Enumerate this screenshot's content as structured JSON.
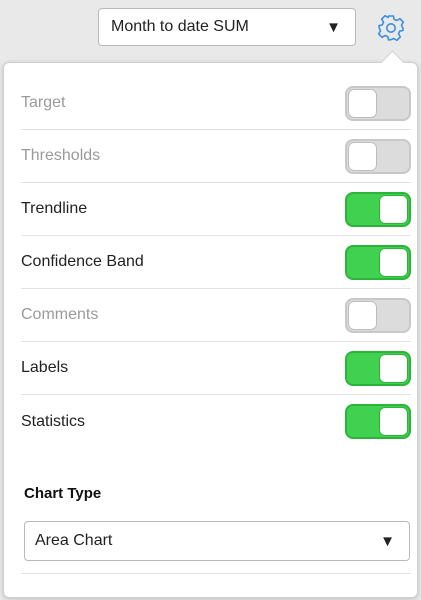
{
  "header": {
    "aggregation_select": {
      "value": "Month to date SUM",
      "caret": "▼"
    },
    "settings_icon": "gear-icon"
  },
  "settings": {
    "rows": [
      {
        "label": "Target",
        "enabled": false,
        "on": false
      },
      {
        "label": "Thresholds",
        "enabled": false,
        "on": false
      },
      {
        "label": "Trendline",
        "enabled": true,
        "on": true
      },
      {
        "label": "Confidence Band",
        "enabled": true,
        "on": true
      },
      {
        "label": "Comments",
        "enabled": false,
        "on": false
      },
      {
        "label": "Labels",
        "enabled": true,
        "on": true
      },
      {
        "label": "Statistics",
        "enabled": true,
        "on": true
      }
    ],
    "chart_type": {
      "title": "Chart Type",
      "value": "Area Chart",
      "caret": "▼"
    }
  },
  "colors": {
    "accent": "#3b8ee0",
    "toggle_on": "#3fd14f",
    "toggle_on_border": "#2cb43a",
    "toggle_off": "#dcdcdc",
    "disabled_text": "#9a9a9a"
  }
}
